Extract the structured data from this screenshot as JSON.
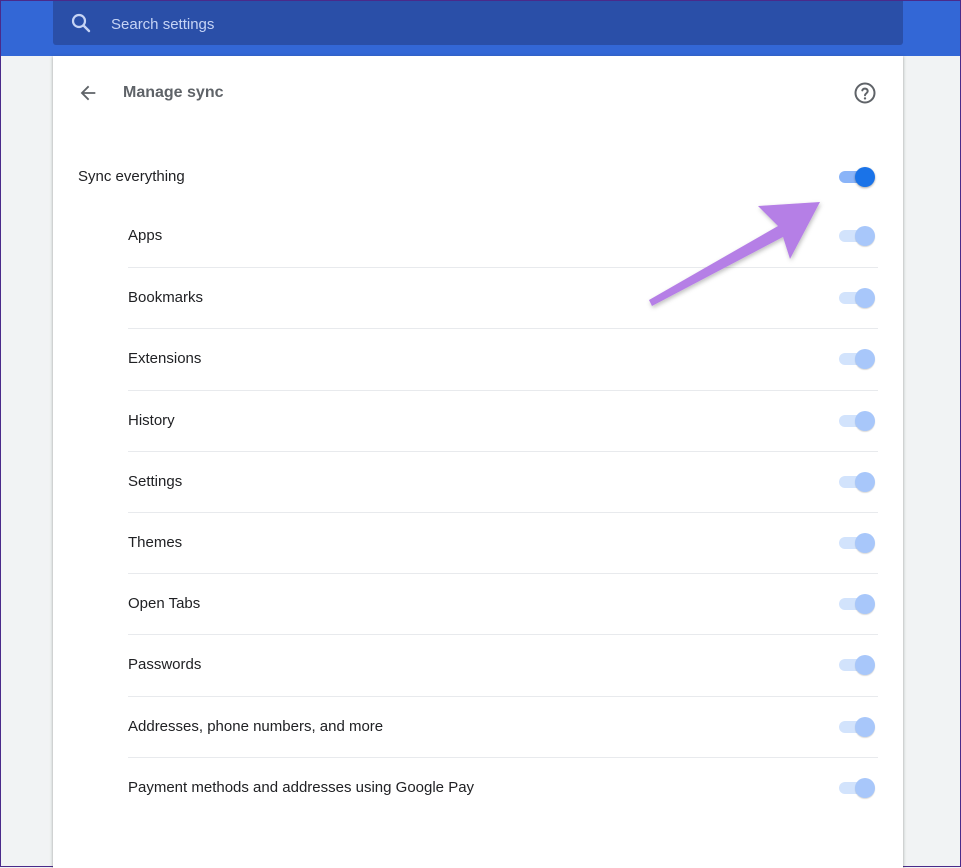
{
  "search": {
    "placeholder": "Search settings"
  },
  "header": {
    "title": "Manage sync"
  },
  "sync_everything": {
    "label": "Sync everything",
    "enabled": true
  },
  "items": [
    {
      "label": "Apps"
    },
    {
      "label": "Bookmarks"
    },
    {
      "label": "Extensions"
    },
    {
      "label": "History"
    },
    {
      "label": "Settings"
    },
    {
      "label": "Themes"
    },
    {
      "label": "Open Tabs"
    },
    {
      "label": "Passwords"
    },
    {
      "label": "Addresses, phone numbers, and more"
    },
    {
      "label": "Payment methods and addresses using Google Pay"
    }
  ],
  "colors": {
    "toolbar": "#3367d6",
    "search_box": "#2a4fa8",
    "toggle_on": "#1a73e8",
    "toggle_disabled": "#a8c7fa",
    "annotation_arrow": "#b57fe6"
  },
  "icons": {
    "search": "search-icon",
    "back": "arrow-left-icon",
    "help": "help-circle-icon"
  }
}
